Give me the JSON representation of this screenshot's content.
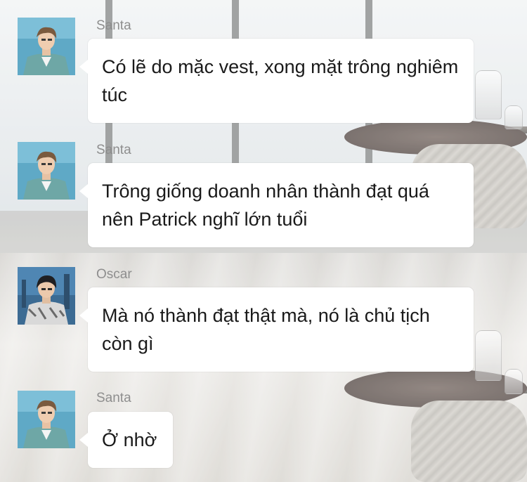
{
  "messages": [
    {
      "sender": "Santa",
      "avatar_icon": "santa-avatar",
      "text": "Có lẽ do mặc vest, xong mặt trông nghiêm túc"
    },
    {
      "sender": "Santa",
      "avatar_icon": "santa-avatar",
      "text": "Trông giống doanh nhân thành đạt quá nên Patrick nghĩ lớn tuổi"
    },
    {
      "sender": "Oscar",
      "avatar_icon": "oscar-avatar",
      "text": "Mà nó thành đạt thật mà, nó là chủ tịch còn gì"
    },
    {
      "sender": "Santa",
      "avatar_icon": "santa-avatar",
      "text": "Ở nhờ"
    }
  ],
  "colors": {
    "bubble": "#ffffff",
    "sender_name": "#8e8e8e",
    "message_text": "#1a1a1a",
    "santa_avatar_bg": "#5fa9c6",
    "oscar_avatar_bg": "#3c6b93"
  }
}
